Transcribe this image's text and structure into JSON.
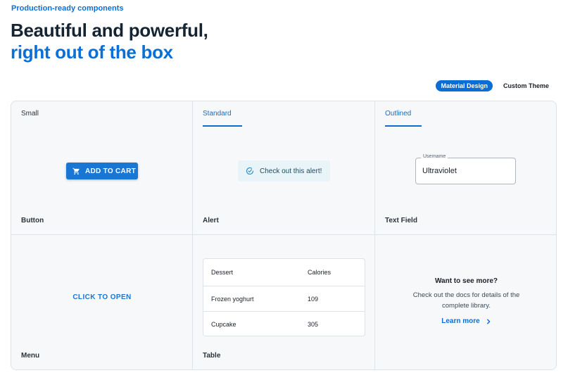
{
  "hero": {
    "eyebrow": "Production-ready components",
    "headline_line1": "Beautiful and powerful,",
    "headline_line2": "right out of the box"
  },
  "theme_toggle": {
    "options": [
      "Material Design",
      "Custom Theme"
    ],
    "selected": "Material Design"
  },
  "cells": {
    "button": {
      "variant_tab": "Small",
      "button_label": "ADD TO CART",
      "button_icon": "cart-icon",
      "label": "Button"
    },
    "alert": {
      "variant_tab": "Standard",
      "message": "Check out this alert!",
      "icon": "check-circle-icon",
      "label": "Alert"
    },
    "text_field": {
      "variant_tab": "Outlined",
      "field_label": "Username",
      "field_value": "Ultraviolet",
      "label": "Text Field"
    },
    "menu": {
      "trigger_label": "CLICK TO OPEN",
      "label": "Menu"
    },
    "table": {
      "columns": [
        "Dessert",
        "Calories"
      ],
      "rows": [
        [
          "Frozen yoghurt",
          "109"
        ],
        [
          "Cupcake",
          "305"
        ]
      ],
      "label": "Table"
    },
    "more": {
      "title": "Want to see more?",
      "description": "Check out the docs for details of the complete library.",
      "link_label": "Learn more",
      "link_icon": "chevron-right-icon"
    }
  },
  "colors": {
    "primary": "#1976d2",
    "headline_dark": "#142433",
    "headline_blue": "#0a6fd6",
    "alert_bg": "#e8f4f8"
  }
}
